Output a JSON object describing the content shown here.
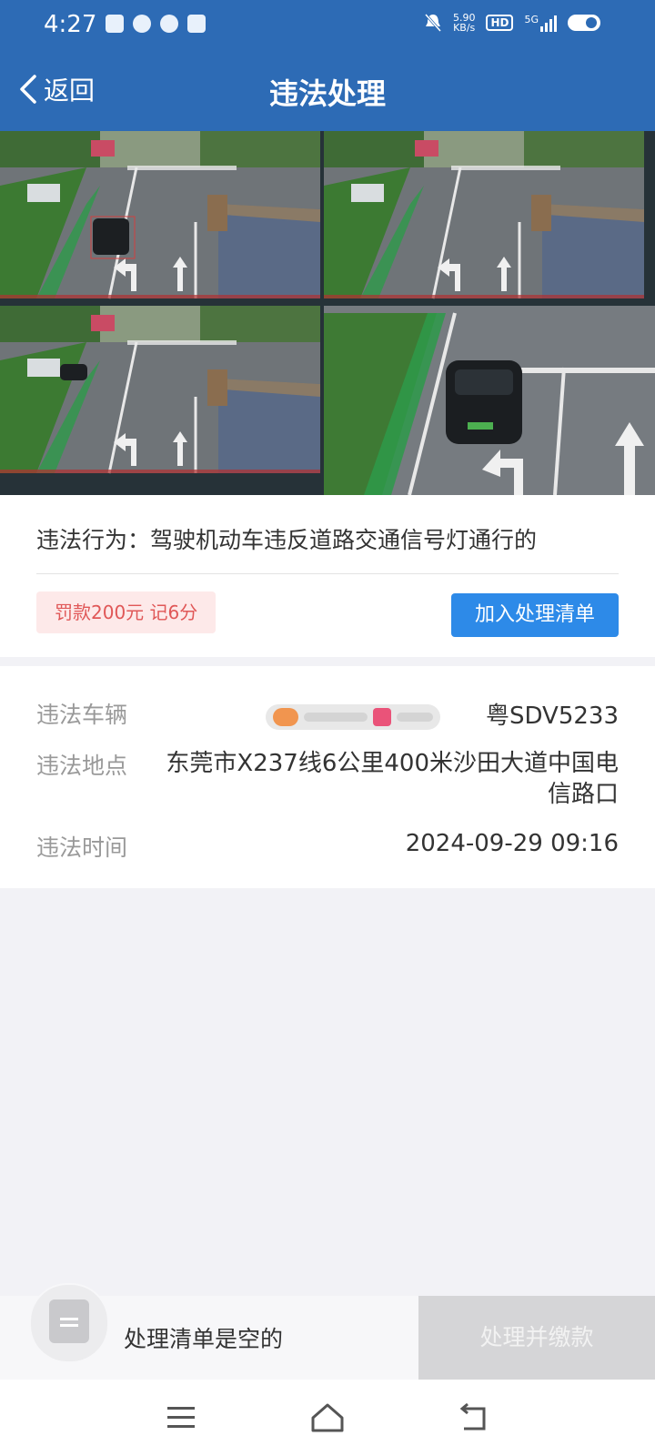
{
  "status_bar": {
    "time": "4:27",
    "net_speed_value": "5.90",
    "net_speed_unit": "KB/s",
    "hd_label": "HD",
    "signal_label": "5G",
    "icons": [
      "app-icon",
      "chat-bubble-icon",
      "wechat-icon",
      "baidu-icon",
      "mute-icon",
      "signal-icon",
      "battery-icon"
    ]
  },
  "navbar": {
    "back_label": "返回",
    "title": "违法处理"
  },
  "photos": {
    "count": 4,
    "active_index": 0
  },
  "violation": {
    "behavior": "违法行为：驾驶机动车违反道路交通信号灯通行的",
    "fine_badge": "罚款200元 记6分",
    "add_button": "加入处理清单"
  },
  "details": {
    "vehicle_label": "违法车辆",
    "vehicle_value": "粤SDV5233",
    "location_label": "违法地点",
    "location_value": "东莞市X237线6公里400米沙田大道中国电信路口",
    "time_label": "违法时间",
    "time_value": "2024-09-29 09:16"
  },
  "bottom_bar": {
    "empty_text": "处理清单是空的",
    "pay_button": "处理并缴款"
  },
  "colors": {
    "primary": "#2d6bb5",
    "button_blue": "#2d8ae8",
    "fine_text": "#e05757",
    "fine_bg": "#fde9e9"
  }
}
